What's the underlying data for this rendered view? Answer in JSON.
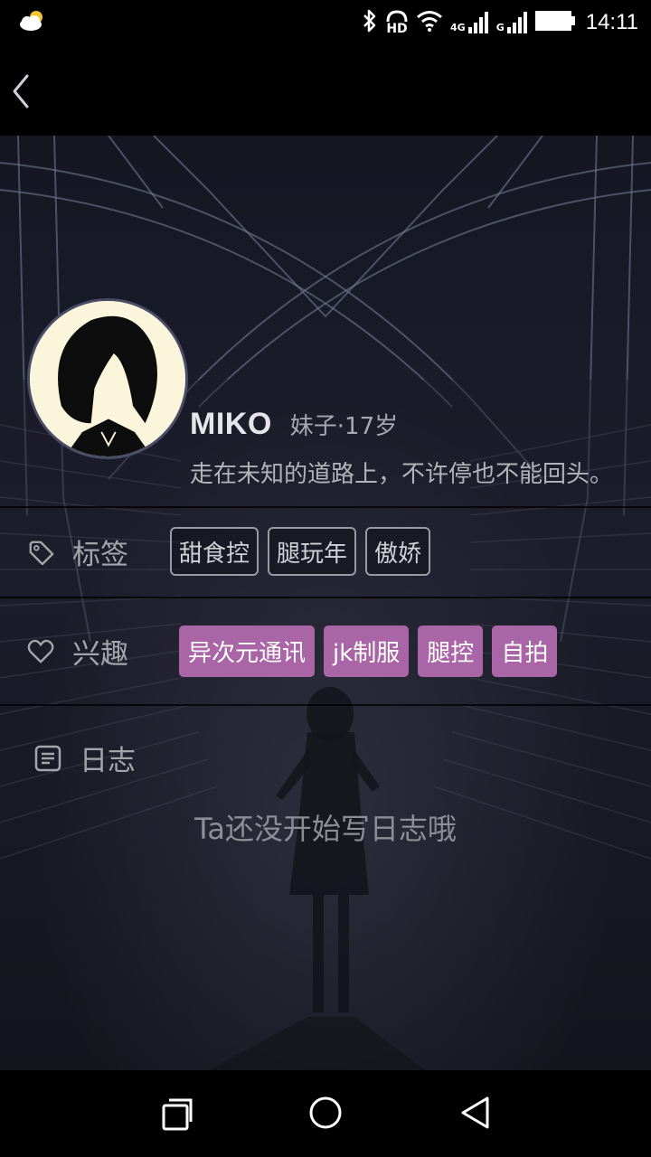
{
  "status_bar": {
    "time": "14:11",
    "hd_label": "HD",
    "network_primary": "4G",
    "network_secondary": "G",
    "icons": [
      "weather-cloudy-icon",
      "bluetooth-icon",
      "hd-voice-icon",
      "wifi-icon",
      "signal-icon",
      "signal-icon",
      "battery-icon"
    ]
  },
  "app_bar": {
    "back_icon": "chevron-left-icon"
  },
  "profile": {
    "name": "MIKO",
    "meta": "妹子·17岁",
    "bio": "走在未知的道路上，不许停也不能回头。"
  },
  "tags_section": {
    "label": "标签",
    "icon": "tag-icon",
    "items": [
      "甜食控",
      "腿玩年",
      "傲娇"
    ]
  },
  "interests_section": {
    "label": "兴趣",
    "icon": "heart-icon",
    "accent_color": "#a965a6",
    "items": [
      "异次元通讯",
      "jk制服",
      "腿控",
      "自拍"
    ]
  },
  "journal_section": {
    "label": "日志",
    "icon": "journal-icon",
    "empty_text": "Ta还没开始写日志哦"
  },
  "nav_bar": {
    "icons": [
      "recent-apps-icon",
      "home-icon",
      "back-triangle-icon"
    ]
  }
}
